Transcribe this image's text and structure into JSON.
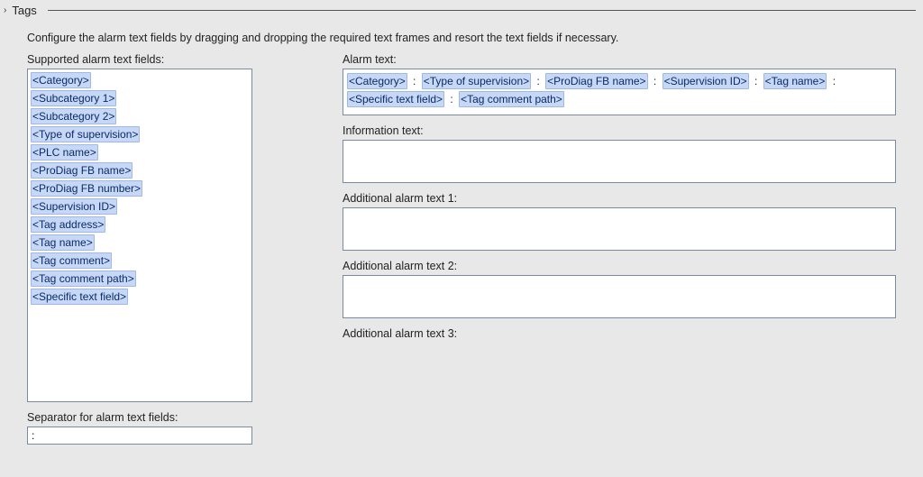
{
  "header": {
    "title": "Tags"
  },
  "intro": "Configure the alarm text fields by dragging and dropping the required text frames and resort the text fields if necessary.",
  "supported": {
    "label": "Supported alarm text fields:",
    "items": [
      "<Category>",
      "<Subcategory 1>",
      "<Subcategory 2>",
      "<Type of supervision>",
      "<PLC name>",
      "<ProDiag FB name>",
      "<ProDiag FB number>",
      "<Supervision ID>",
      "<Tag address>",
      "<Tag name>",
      "<Tag comment>",
      "<Tag comment path>",
      "<Specific text field>"
    ]
  },
  "separator": {
    "label": "Separator for alarm text fields:",
    "value": ":"
  },
  "alarm": {
    "label": "Alarm text:",
    "tokens": [
      "<Category>",
      "<Type of supervision>",
      "<ProDiag FB name>",
      "<Supervision ID>",
      "<Tag name>",
      "<Specific text field>",
      "<Tag comment path>"
    ],
    "sep": ":"
  },
  "info": {
    "label": "Information text:"
  },
  "add1": {
    "label": "Additional alarm text 1:"
  },
  "add2": {
    "label": "Additional alarm text 2:"
  },
  "add3": {
    "label": "Additional alarm text 3:"
  }
}
